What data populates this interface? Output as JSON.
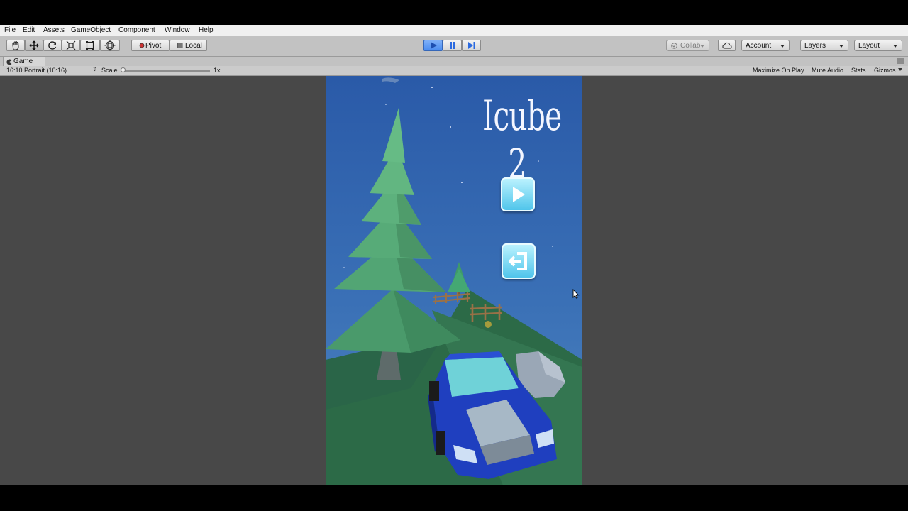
{
  "menu": [
    "File",
    "Edit",
    "Assets",
    "GameObject",
    "Component",
    "Window",
    "Help"
  ],
  "toolbar": {
    "tools": [
      "hand-icon",
      "move-icon",
      "rotate-icon",
      "scale-icon",
      "rect-icon",
      "transform-icon"
    ],
    "pivot_label": "Pivot",
    "local_label": "Local",
    "play_controls": [
      "play-icon",
      "pause-icon",
      "step-icon"
    ],
    "collab_label": "Collab",
    "account_label": "Account",
    "layers_label": "Layers",
    "layout_label": "Layout",
    "play_active_color": "#4a8cf0"
  },
  "game_tab": {
    "label": "Game",
    "aspect": "16:10 Portrait (10:16)",
    "scale_label": "Scale",
    "scale_value": "1x",
    "maximize_label": "Maximize On Play",
    "mute_label": "Mute Audio",
    "stats_label": "Stats",
    "gizmos_label": "Gizmos"
  },
  "game": {
    "title": "Icube 2",
    "play_button_icon": "play-icon",
    "exit_button_icon": "exit-icon",
    "sky_color": "#2c5fae",
    "grass_color": "#2e6b46",
    "car_color": "#1f3fbf"
  }
}
